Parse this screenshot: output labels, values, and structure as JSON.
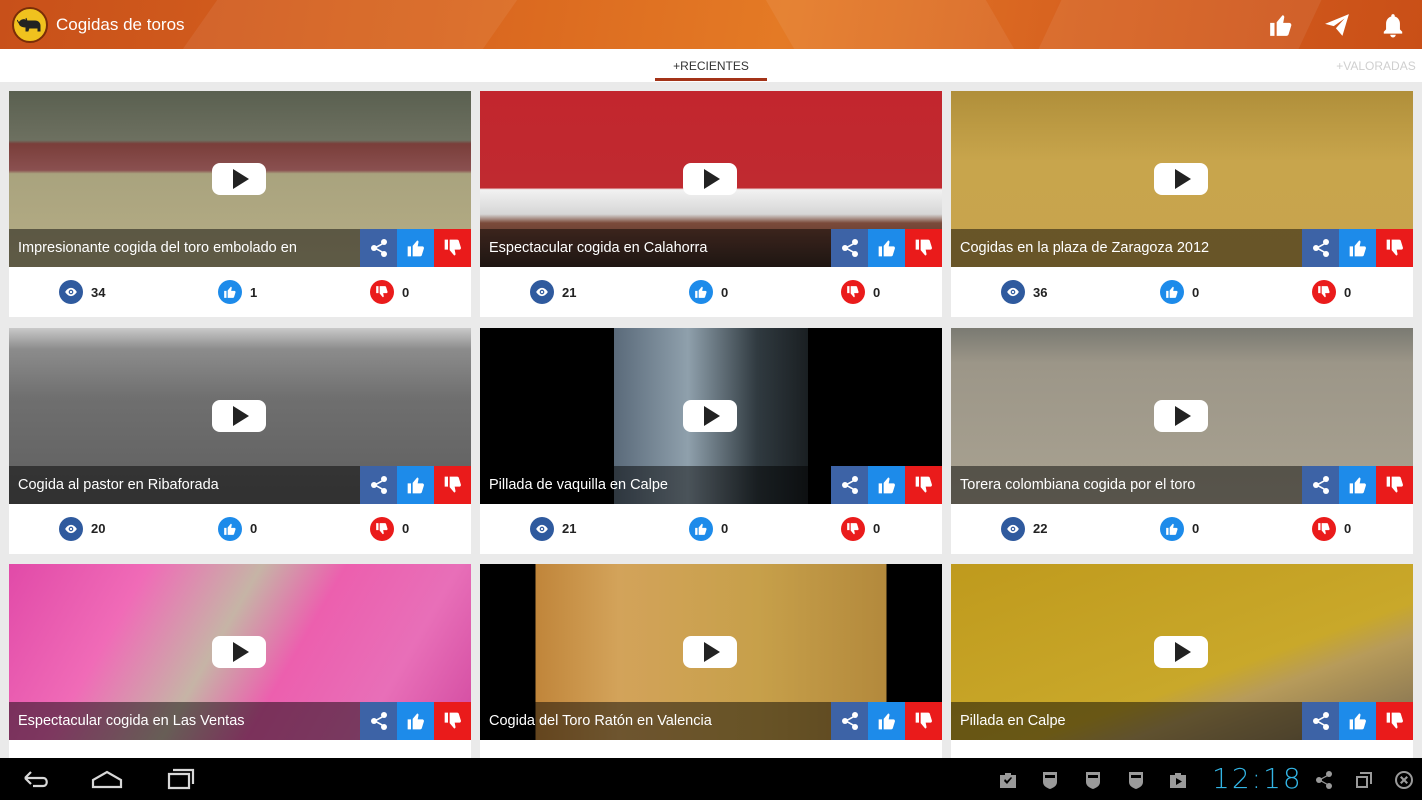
{
  "app": {
    "title": "Cogidas de toros"
  },
  "tabs": [
    {
      "label": "+RECIENTES",
      "active": true
    },
    {
      "label": "+VALORADAS",
      "active": false
    }
  ],
  "colors": {
    "appbar": "#d8641e",
    "share": "#3d63a6",
    "like": "#1d8bea",
    "dislike": "#ea1b1b",
    "views": "#2f5a9e",
    "clock": "#33b5e5"
  },
  "videos": [
    {
      "title": "Impresionante cogida del toro embolado en",
      "views": "34",
      "likes": "1",
      "dislikes": "0"
    },
    {
      "title": "Espectacular cogida en Calahorra",
      "views": "21",
      "likes": "0",
      "dislikes": "0"
    },
    {
      "title": "Cogidas en la plaza de Zaragoza 2012",
      "views": "36",
      "likes": "0",
      "dislikes": "0"
    },
    {
      "title": "Cogida al pastor en Ribaforada",
      "views": "20",
      "likes": "0",
      "dislikes": "0"
    },
    {
      "title": "Pillada de vaquilla en Calpe",
      "views": "21",
      "likes": "0",
      "dislikes": "0"
    },
    {
      "title": "Torera colombiana cogida por el toro",
      "views": "22",
      "likes": "0",
      "dislikes": "0"
    },
    {
      "title": "Espectacular cogida en Las Ventas",
      "views": "",
      "likes": "",
      "dislikes": ""
    },
    {
      "title": "Cogida del Toro Ratón en Valencia",
      "views": "",
      "likes": "",
      "dislikes": ""
    },
    {
      "title": "Pillada en Calpe",
      "views": "",
      "likes": "",
      "dislikes": ""
    }
  ],
  "system": {
    "clock": "12:18"
  }
}
